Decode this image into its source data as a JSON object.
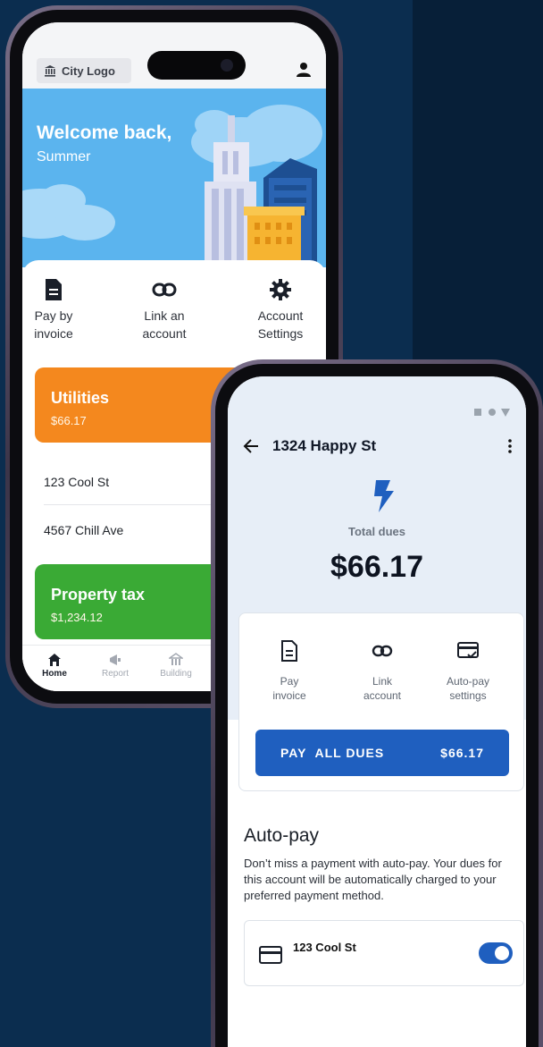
{
  "phone1": {
    "logo_label": "City Logo",
    "welcome_title": "Welcome back,",
    "user_name": "Summer",
    "quick_actions": [
      {
        "label_line1": "Pay by",
        "label_line2": "invoice",
        "icon": "invoice-icon"
      },
      {
        "label_line1": "Link an",
        "label_line2": "account",
        "icon": "link-icon"
      },
      {
        "label_line1": "Account",
        "label_line2": "Settings",
        "icon": "gear-icon"
      }
    ],
    "utilities": {
      "title": "Utilities",
      "amount": "$66.17"
    },
    "addresses": [
      "123 Cool St",
      "4567 Chill Ave"
    ],
    "property_tax": {
      "title": "Property tax",
      "amount": "$1,234.12"
    },
    "nav": [
      {
        "label": "Home",
        "icon": "home-icon"
      },
      {
        "label": "Report",
        "icon": "megaphone-icon"
      },
      {
        "label": "Building",
        "icon": "building-icon"
      }
    ]
  },
  "phone2": {
    "title": "1324 Happy St",
    "total_label": "Total dues",
    "total_value": "$66.17",
    "actions": [
      {
        "label_line1": "Pay",
        "label_line2": "invoice",
        "icon": "invoice-icon"
      },
      {
        "label_line1": "Link",
        "label_line2": "account",
        "icon": "link-icon"
      },
      {
        "label_line1": "Auto-pay",
        "label_line2": "settings",
        "icon": "card-check-icon"
      }
    ],
    "pay_all_label": "PAY  ALL DUES",
    "pay_all_amount": "$66.17",
    "autopay_heading": "Auto-pay",
    "autopay_description": "Don’t miss a payment with auto-pay. Your dues for this account will be automatically charged to your preferred payment method.",
    "autopay_address": "123 Cool St",
    "autopay_enabled": true
  },
  "colors": {
    "background": "#0b2d4f",
    "hero_blue": "#5bb4ee",
    "utilities_orange": "#f4881e",
    "property_tax_green": "#3aaa35",
    "primary_blue": "#1f5fbf"
  }
}
